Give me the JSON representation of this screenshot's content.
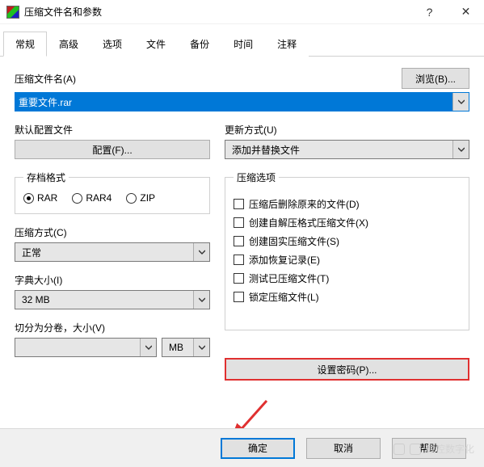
{
  "window": {
    "title": "压缩文件名和参数",
    "help_glyph": "?",
    "close_glyph": "✕"
  },
  "tabs": {
    "items": [
      {
        "label": "常规",
        "active": true
      },
      {
        "label": "高级",
        "active": false
      },
      {
        "label": "选项",
        "active": false
      },
      {
        "label": "文件",
        "active": false
      },
      {
        "label": "备份",
        "active": false
      },
      {
        "label": "时间",
        "active": false
      },
      {
        "label": "注释",
        "active": false
      }
    ]
  },
  "browse_button": "浏览(B)...",
  "archive_name": {
    "label": "压缩文件名(A)",
    "value": "重要文件.rar"
  },
  "default_profile": {
    "label": "默认配置文件",
    "button": "配置(F)..."
  },
  "update_mode": {
    "label": "更新方式(U)",
    "value": "添加并替换文件"
  },
  "archive_format": {
    "legend": "存档格式",
    "options": [
      {
        "label": "RAR",
        "checked": true
      },
      {
        "label": "RAR4",
        "checked": false
      },
      {
        "label": "ZIP",
        "checked": false
      }
    ]
  },
  "compression_method": {
    "label": "压缩方式(C)",
    "value": "正常"
  },
  "dictionary_size": {
    "label": "字典大小(I)",
    "value": "32 MB"
  },
  "split_volumes": {
    "label": "切分为分卷，大小(V)",
    "value": "",
    "unit": "MB"
  },
  "archive_options": {
    "legend": "压缩选项",
    "items": [
      {
        "label": "压缩后删除原来的文件(D)",
        "checked": false
      },
      {
        "label": "创建自解压格式压缩文件(X)",
        "checked": false
      },
      {
        "label": "创建固实压缩文件(S)",
        "checked": false
      },
      {
        "label": "添加恢复记录(E)",
        "checked": false
      },
      {
        "label": "测试已压缩文件(T)",
        "checked": false
      },
      {
        "label": "锁定压缩文件(L)",
        "checked": false
      }
    ]
  },
  "set_password_button": "设置密码(P)...",
  "buttons": {
    "ok": "确定",
    "cancel": "取消",
    "help": "帮助"
  },
  "watermark": "数控数字化"
}
